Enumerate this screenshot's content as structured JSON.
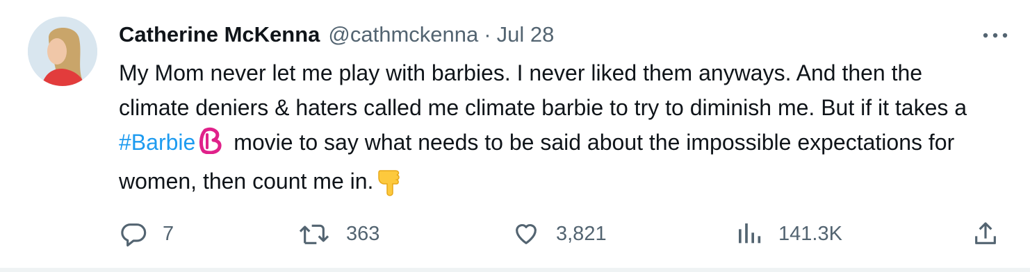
{
  "tweet": {
    "author_name": "Catherine McKenna",
    "handle": "@cathmckenna",
    "separator": "·",
    "date": "Jul 28",
    "text_part1": "My Mom never let me play with barbies. I never liked them anyways. And then the climate deniers & haters called me climate barbie to try to diminish me. But if it takes a ",
    "hashtag": "#Barbie",
    "text_part2": " movie to say what needs to be said about the impossible expectations for women, then count me in.",
    "emojis": [
      "barbie-b-emoji",
      "pointing-down-hand-emoji"
    ]
  },
  "actions": {
    "replies": "7",
    "retweets": "363",
    "likes": "3,821",
    "views": "141.3K"
  },
  "icons": {
    "more": "more-dots-icon",
    "reply": "reply-bubble-icon",
    "retweet": "retweet-icon",
    "like": "heart-icon",
    "views": "bar-chart-icon",
    "share": "share-upload-icon"
  },
  "colors": {
    "text": "#0f1419",
    "secondary": "#536471",
    "hashtag": "#1d9bf0",
    "barbie_pink": "#e0218a"
  }
}
